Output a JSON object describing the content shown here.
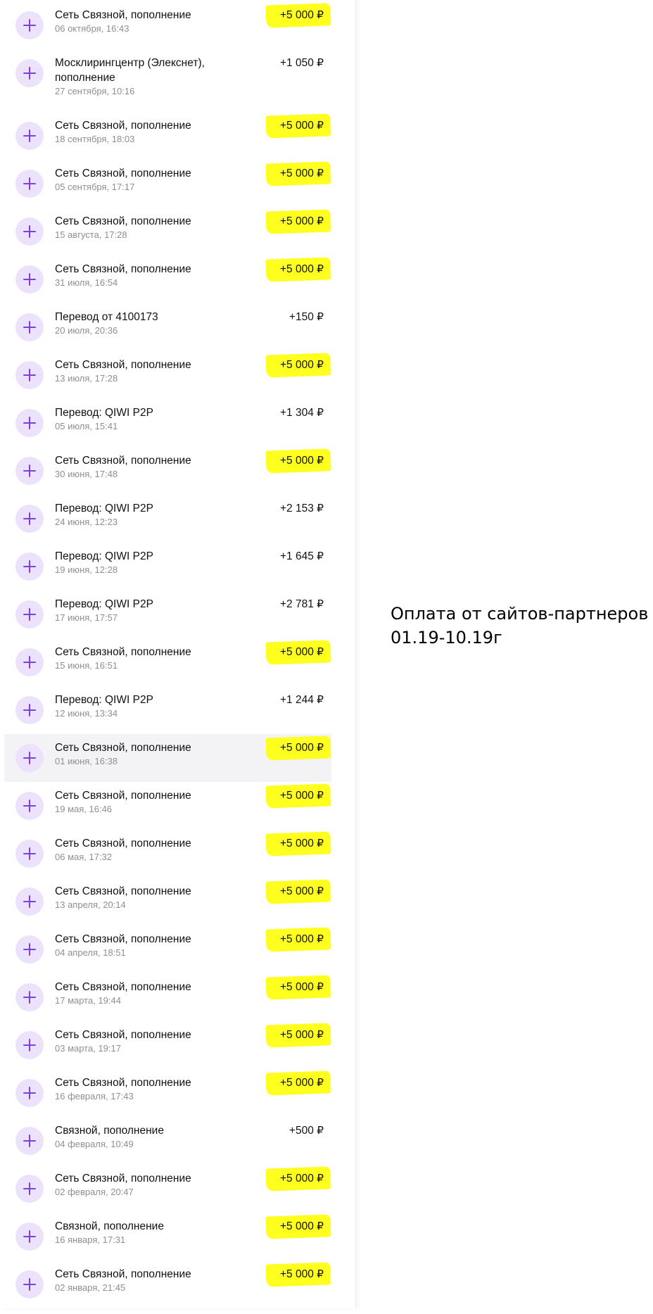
{
  "transactions": [
    {
      "title": "Сеть Связной, пополнение",
      "date": "06 октября, 16:43",
      "amount": "+5 000 ₽",
      "highlighted": true
    },
    {
      "title": "Москлирингцентр (Элекснет),\nпополнение",
      "date": "27 сентября, 10:16",
      "amount": "+1 050 ₽",
      "highlighted": false
    },
    {
      "title": "Сеть Связной, пополнение",
      "date": "18 сентября, 18:03",
      "amount": "+5 000 ₽",
      "highlighted": true
    },
    {
      "title": "Сеть Связной, пополнение",
      "date": "05 сентября, 17:17",
      "amount": "+5 000 ₽",
      "highlighted": true
    },
    {
      "title": "Сеть Связной, пополнение",
      "date": "15 августа, 17:28",
      "amount": "+5 000 ₽",
      "highlighted": true
    },
    {
      "title": "Сеть Связной, пополнение",
      "date": "31 июля, 16:54",
      "amount": "+5 000 ₽",
      "highlighted": true
    },
    {
      "title": "Перевод от 4100173",
      "date": "20 июля, 20:36",
      "amount": "+150 ₽",
      "highlighted": false
    },
    {
      "title": "Сеть Связной, пополнение",
      "date": "13 июля, 17:28",
      "amount": "+5 000 ₽",
      "highlighted": true
    },
    {
      "title": "Перевод: QIWI P2P",
      "date": "05 июля, 15:41",
      "amount": "+1 304 ₽",
      "highlighted": false
    },
    {
      "title": "Сеть Связной, пополнение",
      "date": "30 июня, 17:48",
      "amount": "+5 000 ₽",
      "highlighted": true
    },
    {
      "title": "Перевод: QIWI P2P",
      "date": "24 июня, 12:23",
      "amount": "+2 153 ₽",
      "highlighted": false
    },
    {
      "title": "Перевод: QIWI P2P",
      "date": "19 июня, 12:28",
      "amount": "+1 645 ₽",
      "highlighted": false
    },
    {
      "title": "Перевод: QIWI P2P",
      "date": "17 июня, 17:57",
      "amount": "+2 781 ₽",
      "highlighted": false
    },
    {
      "title": "Сеть Связной, пополнение",
      "date": "15 июня, 16:51",
      "amount": "+5 000 ₽",
      "highlighted": true
    },
    {
      "title": "Перевод: QIWI P2P",
      "date": "12 июня, 13:34",
      "amount": "+1 244 ₽",
      "highlighted": false
    },
    {
      "title": "Сеть Связной, пополнение",
      "date": "01 июня, 16:38",
      "amount": "+5 000 ₽",
      "highlighted": true,
      "hover": true
    },
    {
      "title": "Сеть Связной, пополнение",
      "date": "19 мая, 16:46",
      "amount": "+5 000 ₽",
      "highlighted": true
    },
    {
      "title": "Сеть Связной, пополнение",
      "date": "06 мая, 17:32",
      "amount": "+5 000 ₽",
      "highlighted": true
    },
    {
      "title": "Сеть Связной, пополнение",
      "date": "13 апреля, 20:14",
      "amount": "+5 000 ₽",
      "highlighted": true
    },
    {
      "title": "Сеть Связной, пополнение",
      "date": "04 апреля, 18:51",
      "amount": "+5 000 ₽",
      "highlighted": true
    },
    {
      "title": "Сеть Связной, пополнение",
      "date": "17 марта, 19:44",
      "amount": "+5 000 ₽",
      "highlighted": true
    },
    {
      "title": "Сеть Связной, пополнение",
      "date": "03 марта, 19:17",
      "amount": "+5 000 ₽",
      "highlighted": true
    },
    {
      "title": "Сеть Связной, пополнение",
      "date": "16 февраля, 17:43",
      "amount": "+5 000 ₽",
      "highlighted": true
    },
    {
      "title": "Связной, пополнение",
      "date": "04 февраля, 10:49",
      "amount": "+500 ₽",
      "highlighted": false
    },
    {
      "title": "Сеть Связной, пополнение",
      "date": "02 февраля, 20:47",
      "amount": "+5 000 ₽",
      "highlighted": true
    },
    {
      "title": "Связной, пополнение",
      "date": "16 января, 17:31",
      "amount": "+5 000 ₽",
      "highlighted": true
    },
    {
      "title": "Сеть Связной, пополнение",
      "date": "02 января, 21:45",
      "amount": "+5 000 ₽",
      "highlighted": true
    }
  ],
  "icon": "plus-icon",
  "colors": {
    "icon_bg": "#ece2fb",
    "icon_plus": "#7b3fe4",
    "highlight": "#ffff1f",
    "date_text": "#8e8e96"
  },
  "annotation": {
    "line1": "Оплата от сайтов-партнеров",
    "line2": "01.19-10.19г"
  }
}
